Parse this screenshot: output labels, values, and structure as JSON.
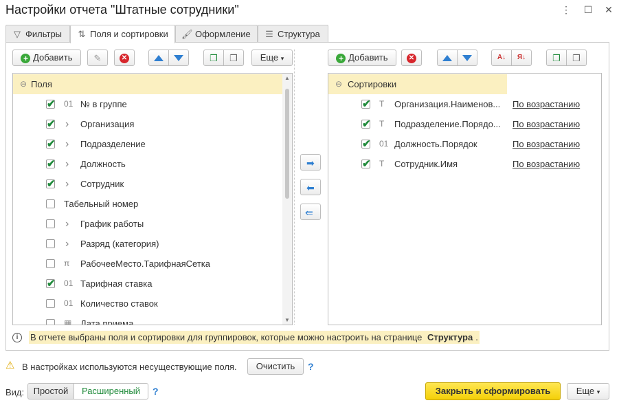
{
  "window": {
    "title": "Настройки отчета \"Штатные сотрудники\""
  },
  "tabs": [
    {
      "label": "Фильтры",
      "icon": "filter-icon"
    },
    {
      "label": "Поля и сортировки",
      "icon": "fields-sort-icon"
    },
    {
      "label": "Оформление",
      "icon": "brush-icon"
    },
    {
      "label": "Структура",
      "icon": "structure-icon"
    }
  ],
  "left_toolbar": {
    "add_label": "Добавить",
    "more_label": "Еще"
  },
  "right_toolbar": {
    "add_label": "Добавить"
  },
  "fields": {
    "header": "Поля",
    "items": [
      {
        "type": "01",
        "label": "№ в группе",
        "checked": true,
        "expandable": false
      },
      {
        "type": "",
        "label": "Организация",
        "checked": true,
        "expandable": true
      },
      {
        "type": "",
        "label": "Подразделение",
        "checked": true,
        "expandable": true
      },
      {
        "type": "",
        "label": "Должность",
        "checked": true,
        "expandable": true
      },
      {
        "type": "",
        "label": "Сотрудник",
        "checked": true,
        "expandable": true
      },
      {
        "type": "",
        "label": "Табельный номер",
        "checked": false,
        "expandable": false
      },
      {
        "type": "",
        "label": "График работы",
        "checked": false,
        "expandable": true
      },
      {
        "type": "",
        "label": "Разряд (категория)",
        "checked": false,
        "expandable": true
      },
      {
        "type": "π",
        "label": "РабочееМесто.ТарифнаяСетка",
        "checked": false,
        "expandable": false
      },
      {
        "type": "01",
        "label": "Тарифная ставка",
        "checked": true,
        "expandable": false
      },
      {
        "type": "01",
        "label": "Количество ставок",
        "checked": false,
        "expandable": false
      },
      {
        "type": "date",
        "label": "Дата приема",
        "checked": false,
        "expandable": false
      }
    ]
  },
  "sorting": {
    "header": "Сортировки",
    "items": [
      {
        "type": "T",
        "label": "Организация.Наименов...",
        "order": "По возрастанию",
        "checked": true
      },
      {
        "type": "T",
        "label": "Подразделение.Порядо...",
        "order": "По возрастанию",
        "checked": true
      },
      {
        "type": "01",
        "label": "Должность.Порядок",
        "order": "По возрастанию",
        "checked": true
      },
      {
        "type": "T",
        "label": "Сотрудник.Имя",
        "order": "По возрастанию",
        "checked": true
      }
    ]
  },
  "info": {
    "text": "В отчете выбраны поля и сортировки для группировок, которые можно настроить на странице ",
    "link": "Структура",
    "suffix": "."
  },
  "warning": {
    "text": "В настройках используются несуществующие поля.",
    "clear_label": "Очистить",
    "help": "?"
  },
  "view": {
    "label": "Вид:",
    "simple": "Простой",
    "advanced": "Расширенный",
    "help": "?"
  },
  "footer": {
    "primary_label": "Закрыть и сформировать",
    "more_label": "Еще"
  },
  "colors": {
    "accent_yellow": "#f4d008",
    "highlight": "#fbf0c1",
    "check_green": "#1f8a3a",
    "arrow_blue": "#2f7fd1"
  }
}
